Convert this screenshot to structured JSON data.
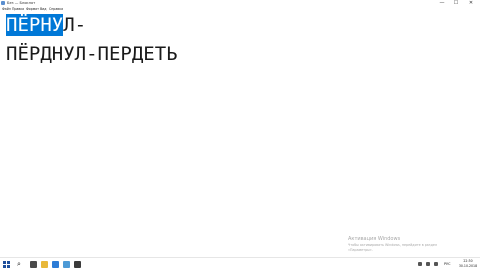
{
  "window": {
    "title": "Без — Блокнот",
    "controls": {
      "minimize": "—",
      "maximize": "☐",
      "close": "✕"
    }
  },
  "menu": {
    "items": [
      "Файл",
      "Правка",
      "Формат",
      "Вид",
      "Справка"
    ]
  },
  "editor": {
    "line1_selected": "ПЁРНУ",
    "line1_rest": "Л-",
    "line2": "ПЁРДНУЛ-ПЕРДЕТЬ",
    "selection_color": "#0078d7"
  },
  "watermark": {
    "title": "Активация Windows",
    "subtitle_1": "Чтобы активировать Windows, перейдите в раздел",
    "subtitle_2": "«Параметры»."
  },
  "taskbar": {
    "search_glyph": "⌕",
    "apps": [
      {
        "name": "task-view",
        "color": "#4a4a4a"
      },
      {
        "name": "file-explorer",
        "color": "#e8b83a"
      },
      {
        "name": "browser",
        "color": "#2c7cd6"
      },
      {
        "name": "notepad",
        "color": "#4d9ad6"
      },
      {
        "name": "app",
        "color": "#3b3b3b"
      }
    ],
    "tray": {
      "language": "РУС",
      "time": "22:30",
      "date": "30.10.2018"
    }
  }
}
